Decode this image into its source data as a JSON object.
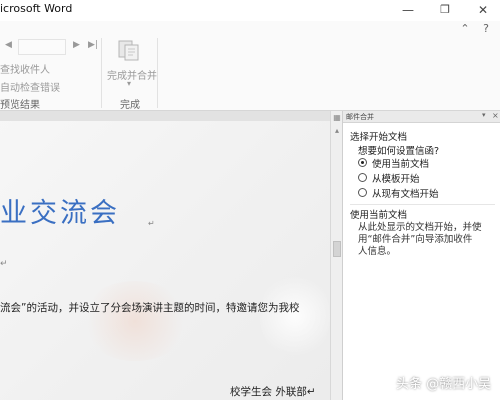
{
  "titlebar": {
    "title": "icrosoft Word",
    "minimize_icon": "—",
    "maximize_icon": "❐",
    "close_icon": "✕",
    "collapse_ribbon_icon": "⌃",
    "help_icon": "?"
  },
  "ribbon": {
    "nav_first_icon": "◀",
    "nav_next_icon": "▶",
    "nav_last_icon": "▶|",
    "find_recipient": "查找收件人",
    "auto_check_errors": "自动检查错误",
    "preview_group_label": "预览结果",
    "finish_merge_label": "完成并合并",
    "finish_merge_dropdown": "▾",
    "finish_group_label": "完成"
  },
  "document": {
    "heading": "业交流会",
    "return_mark": "↵",
    "small_mark": "↵",
    "body_line": "流会”的活动，并设立了分会场演讲主题的时间，特邀请您为我校",
    "signature": "校学生会 外联部↵"
  },
  "pane": {
    "title": "邮件合并",
    "dropdown_icon": "▾",
    "close_icon": "×",
    "section_title": "选择开始文档",
    "question": "想要如何设置信函?",
    "options": [
      {
        "label": "使用当前文档",
        "selected": true
      },
      {
        "label": "从模板开始",
        "selected": false
      },
      {
        "label": "从现有文档开始",
        "selected": false
      }
    ],
    "sub_title": "使用当前文档",
    "desc_lines": [
      "从此处显示的文档开始，并使",
      "用“邮件合并”向导添加收件",
      "人信息。"
    ]
  },
  "watermark": "头条 @赣西小吴"
}
